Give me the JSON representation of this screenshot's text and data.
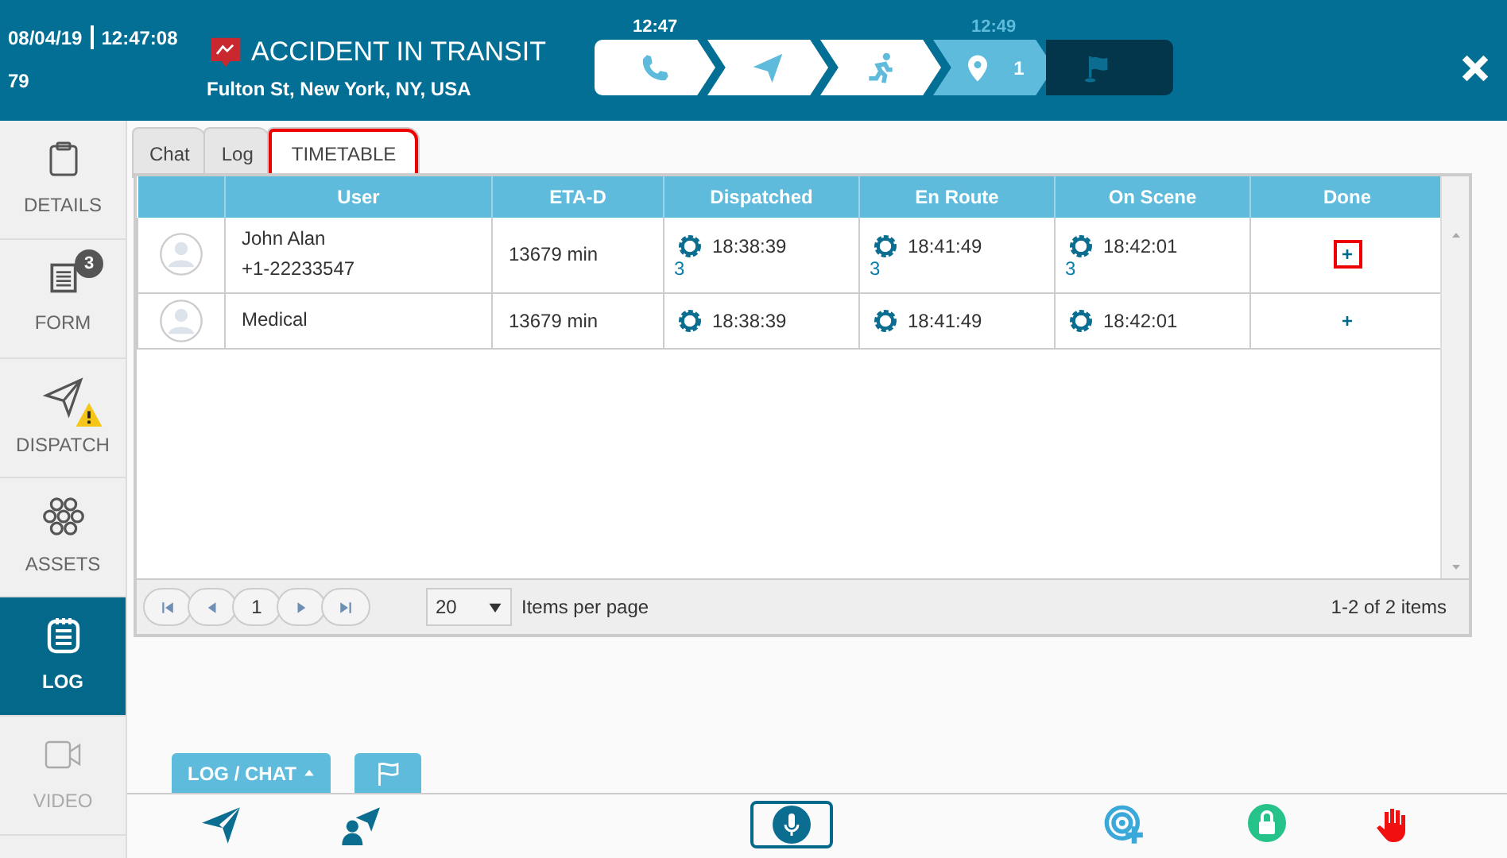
{
  "header": {
    "date": "08/04/19",
    "time": "12:47:08",
    "number": "79",
    "title": "ACCIDENT IN TRANSIT",
    "address": "Fulton St, New York, NY, USA",
    "steps": [
      {
        "kind": "phone",
        "time": "12:47",
        "completed": true,
        "selected": false
      },
      {
        "kind": "send",
        "completed": true,
        "selected": false
      },
      {
        "kind": "run",
        "completed": true,
        "selected": false
      },
      {
        "kind": "pin",
        "time": "12:49",
        "completed": false,
        "selected": true,
        "count": "1"
      },
      {
        "kind": "flag",
        "completed": false,
        "selected": false
      }
    ]
  },
  "sidebar": {
    "items": [
      {
        "label": "DETAILS",
        "kind": "clipboard",
        "selected": false,
        "disabled": false
      },
      {
        "label": "FORM",
        "kind": "form",
        "badge": "3",
        "selected": false,
        "disabled": false
      },
      {
        "label": "DISPATCH",
        "kind": "send",
        "warning": true,
        "selected": false,
        "disabled": false
      },
      {
        "label": "ASSETS",
        "kind": "hex",
        "selected": false,
        "disabled": false
      },
      {
        "label": "LOG",
        "kind": "notepad",
        "selected": true,
        "disabled": false
      },
      {
        "label": "VIDEO",
        "kind": "video",
        "selected": false,
        "disabled": true
      }
    ]
  },
  "tabs": [
    {
      "label": "Chat",
      "selected": false,
      "highlighted": false
    },
    {
      "label": "Log",
      "selected": false,
      "highlighted": false
    },
    {
      "label": "TIMETABLE",
      "selected": true,
      "highlighted": true
    }
  ],
  "table": {
    "columns": [
      "User",
      "ETA-D",
      "Dispatched",
      "En Route",
      "On Scene",
      "Done"
    ],
    "rows": [
      {
        "user": [
          "John Alan",
          "+1-22233547"
        ],
        "eta": "13679 min",
        "times": [
          {
            "time": "18:38:39",
            "count": "3"
          },
          {
            "time": "18:41:49",
            "count": "3"
          },
          {
            "time": "18:42:01",
            "count": "3"
          }
        ],
        "done": {
          "symbol": "+",
          "highlighted": true
        }
      },
      {
        "user": [
          "Medical"
        ],
        "eta": "13679 min",
        "times": [
          {
            "time": "18:38:39"
          },
          {
            "time": "18:41:49"
          },
          {
            "time": "18:42:01"
          }
        ],
        "done": {
          "symbol": "+",
          "highlighted": false
        }
      }
    ]
  },
  "pager": {
    "page": "1",
    "page_size": "20",
    "page_size_label": "Items per page",
    "summary": "1-2 of 2 items"
  },
  "bottom_tabs": [
    {
      "kind": "text",
      "label": "LOG / CHAT"
    },
    {
      "kind": "flag"
    }
  ],
  "toolbar": [
    {
      "kind": "send"
    },
    {
      "kind": "person-send"
    },
    {
      "kind": "mic"
    },
    {
      "kind": "target-add"
    },
    {
      "kind": "lock"
    },
    {
      "kind": "hand"
    }
  ]
}
